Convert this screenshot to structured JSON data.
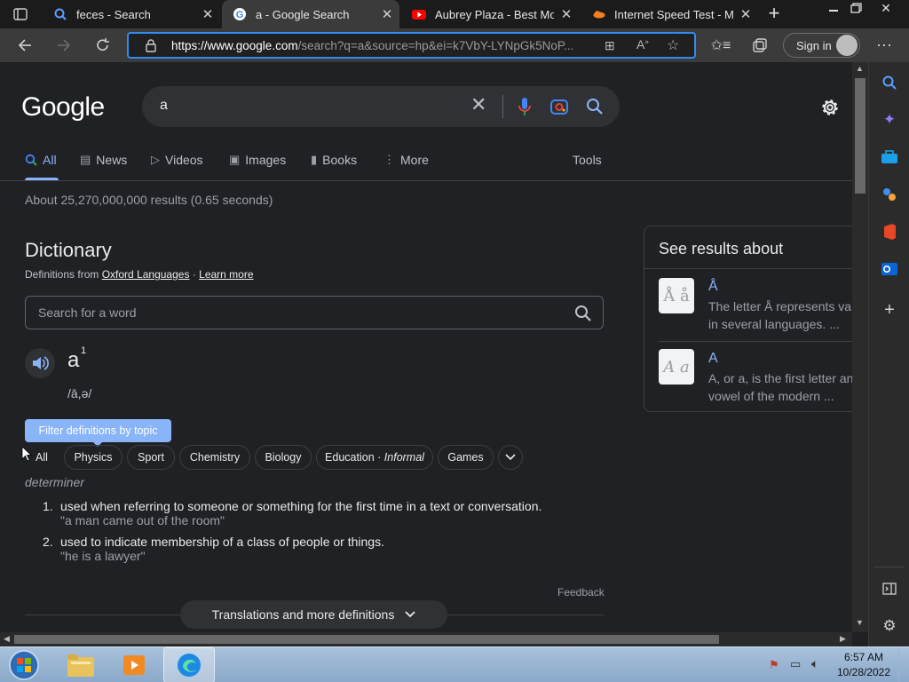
{
  "browser": {
    "tabs": [
      {
        "title": "feces - Search",
        "icon": "bing-search-icon"
      },
      {
        "title": "a - Google Search",
        "icon": "google-icon",
        "active": true
      },
      {
        "title": "Aubrey Plaza - Best Mom",
        "icon": "youtube-icon"
      },
      {
        "title": "Internet Speed Test - Mea",
        "icon": "cloudflare-icon"
      }
    ],
    "url_host": "https://www.google.com",
    "url_rest": "/search?q=a&source=hp&ei=k7VbY-LYNpGk5NoP...",
    "sign_in_label": "Sign in"
  },
  "google": {
    "logo": "Google",
    "query": "a",
    "tabs": [
      "All",
      "News",
      "Videos",
      "Images",
      "Books",
      "More"
    ],
    "tools_label": "Tools",
    "result_stats": "About 25,270,000,000 results (0.65 seconds)"
  },
  "dictionary": {
    "title": "Dictionary",
    "source_prefix": "Definitions from",
    "source_link": "Oxford Languages",
    "source_sep": "·",
    "learn_more": "Learn more",
    "search_placeholder": "Search for a word",
    "headword": "a",
    "homograph": "1",
    "pronunciation": "/ā,ə/",
    "filter_tooltip": "Filter definitions by topic",
    "chips": [
      "All",
      "Physics",
      "Sport",
      "Chemistry",
      "Biology",
      "Games"
    ],
    "chip_education": "Education",
    "chip_education_sep": "·",
    "chip_education_tag": "Informal",
    "part_of_speech": "determiner",
    "definitions": [
      {
        "num": "1.",
        "text": "used when referring to someone or something for the first time in a text or conversation.",
        "example": "\"a man came out of the room\""
      },
      {
        "num": "2.",
        "text": "used to indicate membership of a class of people or things.",
        "example": "\"he is a lawyer\""
      }
    ],
    "feedback": "Feedback",
    "more_button": "Translations and more definitions"
  },
  "see_results": {
    "title": "See results about",
    "items": [
      {
        "name": "Å",
        "desc1": "The letter Å represents var",
        "desc2": "in several languages. ...",
        "thumb": "Å å"
      },
      {
        "name": "A",
        "desc1": "A, or a, is the first letter an",
        "desc2": "vowel of the modern ...",
        "thumb": "A a"
      }
    ]
  },
  "taskbar": {
    "time": "6:57 AM",
    "date": "10/28/2022"
  },
  "colors": {
    "accent_blue": "#8ab4f8",
    "page_bg": "#202124",
    "url_focus": "#2f8cf4"
  }
}
